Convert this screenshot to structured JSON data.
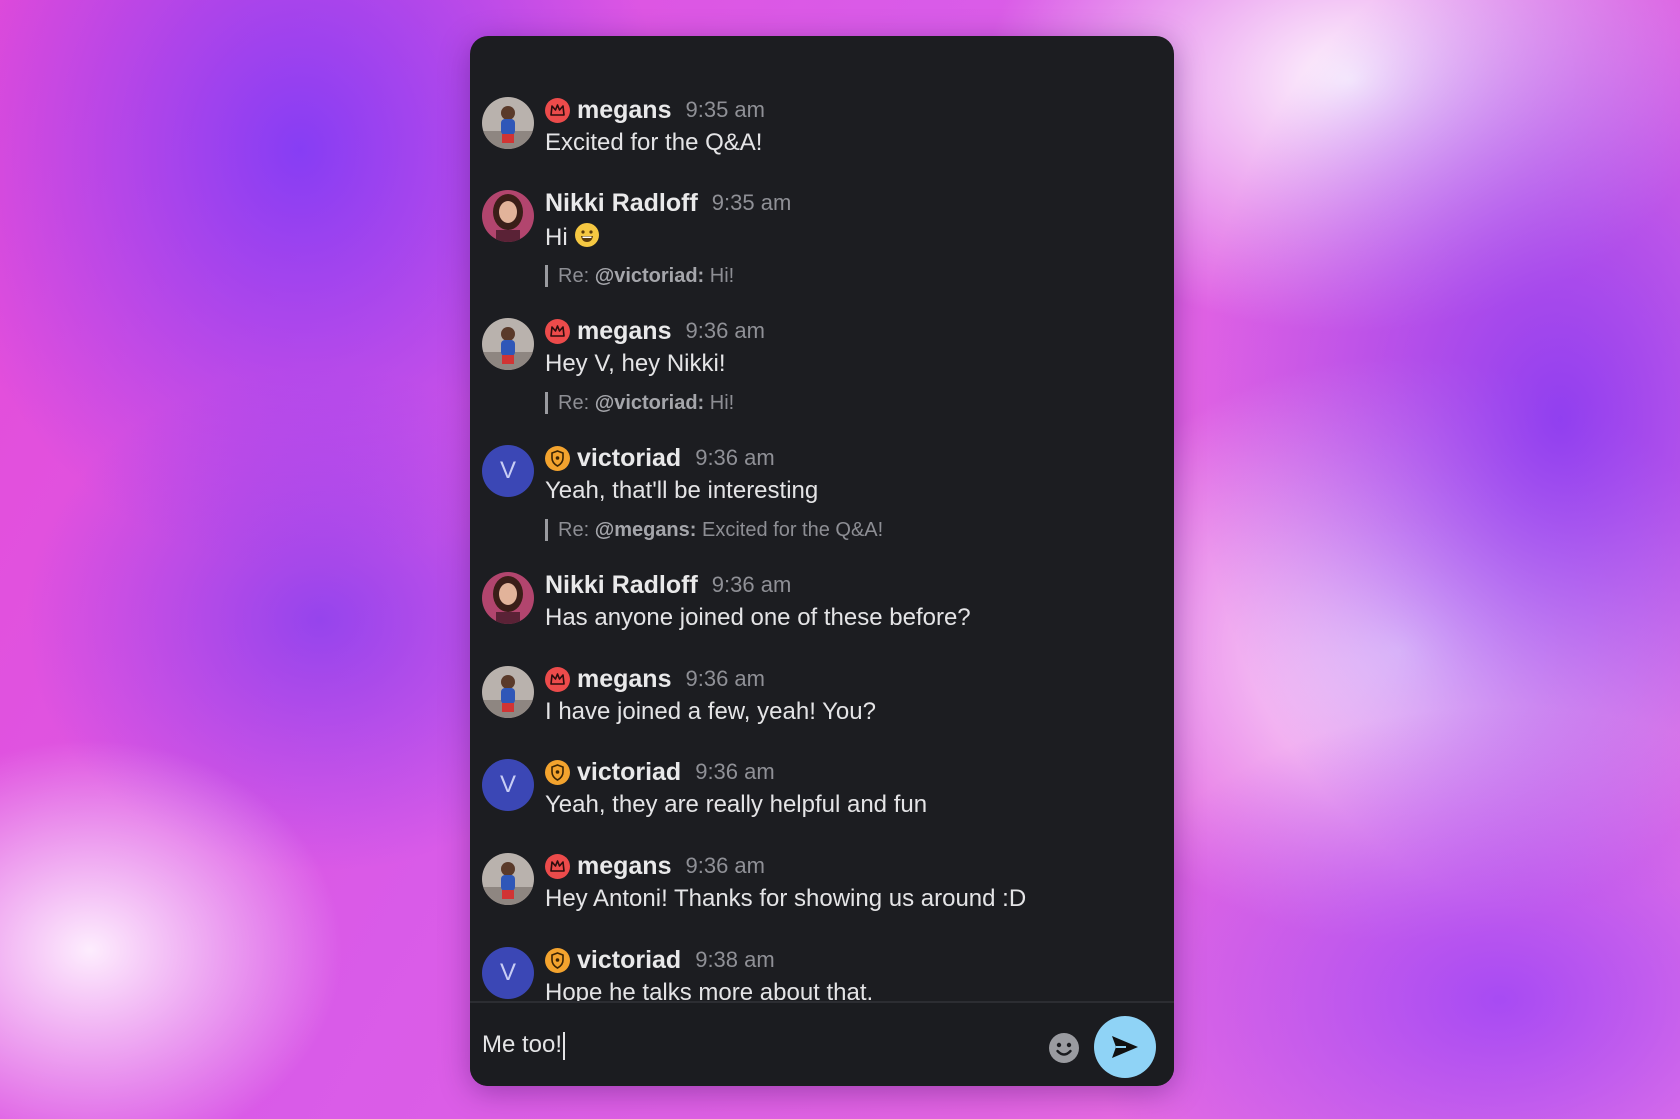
{
  "chat": {
    "messages": [
      {
        "author": "megans",
        "role_icon": "crown-icon",
        "time": "9:35 am",
        "text": "Excited for the Q&A!"
      },
      {
        "author": "Nikki Radloff",
        "time": "9:35 am",
        "text": "Hi",
        "emoji": "grinning-face",
        "reply": {
          "prefix": "Re:",
          "mention": "@victoriad:",
          "text": "Hi!"
        }
      },
      {
        "author": "megans",
        "role_icon": "crown-icon",
        "time": "9:36 am",
        "text": "Hey V, hey Nikki!",
        "reply": {
          "prefix": "Re:",
          "mention": "@victoriad:",
          "text": "Hi!"
        }
      },
      {
        "author": "victoriad",
        "avatar_letter": "V",
        "role_icon": "shield-icon",
        "time": "9:36 am",
        "text": "Yeah, that'll be interesting",
        "reply": {
          "prefix": "Re:",
          "mention": "@megans:",
          "text": "Excited for the Q&A!"
        }
      },
      {
        "author": "Nikki Radloff",
        "time": "9:36 am",
        "text": "Has anyone joined one of these before?"
      },
      {
        "author": "megans",
        "role_icon": "crown-icon",
        "time": "9:36 am",
        "text": "I have joined a few, yeah! You?"
      },
      {
        "author": "victoriad",
        "avatar_letter": "V",
        "role_icon": "shield-icon",
        "time": "9:36 am",
        "text": "Yeah, they are really helpful and fun"
      },
      {
        "author": "megans",
        "role_icon": "crown-icon",
        "time": "9:36 am",
        "text": "Hey Antoni! Thanks for showing us around :D"
      },
      {
        "author": "victoriad",
        "avatar_letter": "V",
        "role_icon": "shield-icon",
        "time": "9:38 am",
        "text": "Hope he talks more about that."
      }
    ]
  },
  "composer": {
    "value": "Me too!",
    "emoji_icon": "smiley-icon",
    "send_icon": "send-arrow-icon"
  },
  "colors": {
    "panel_bg": "#1c1d21",
    "crown_badge": "#ec4b4b",
    "shield_badge": "#f3a32e",
    "letter_avatar": "#3b47b5",
    "send_button": "#8fd3f6"
  }
}
